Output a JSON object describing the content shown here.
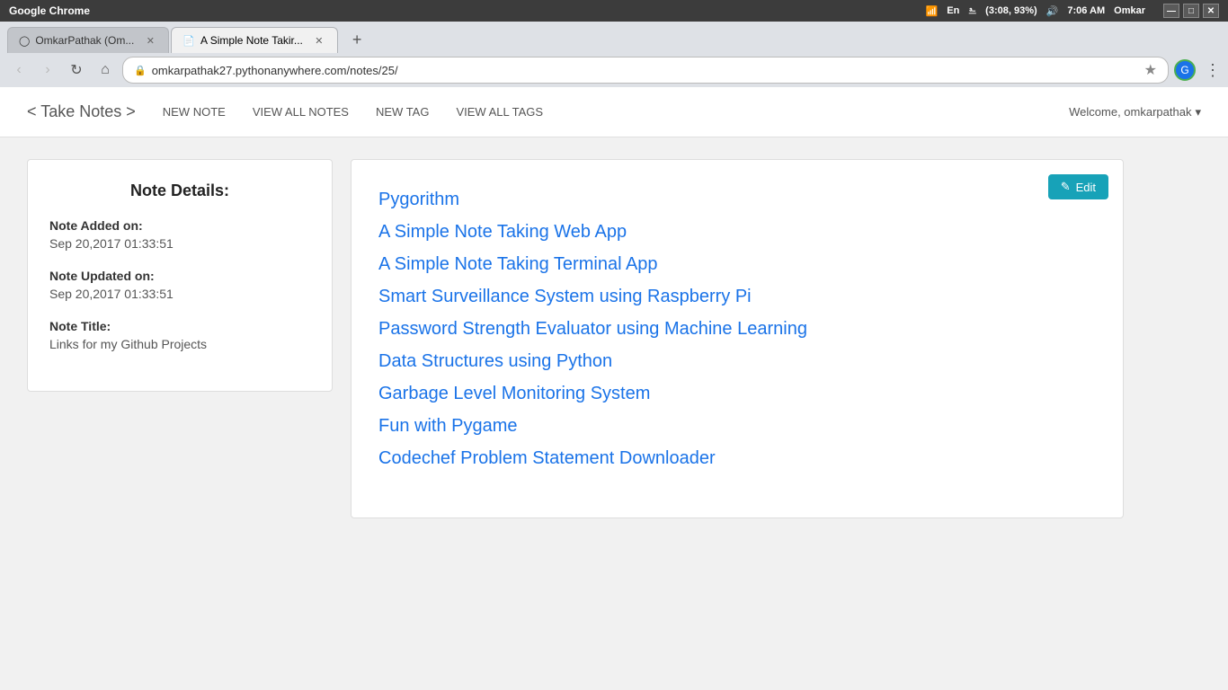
{
  "os": {
    "titlebar": "Google Chrome",
    "status_right": {
      "wifi": "wifi",
      "lang": "En",
      "bluetooth": "bluetooth",
      "battery": "(3:08, 93%)",
      "volume": "volume",
      "time": "7:06 AM",
      "user": "Omkar"
    },
    "window_controls": {
      "minimize": "—",
      "maximize": "□",
      "close": "✕"
    }
  },
  "browser": {
    "tabs": [
      {
        "id": "tab1",
        "icon": "github",
        "label": "OmkarPathak (Om...",
        "active": false,
        "close": "✕"
      },
      {
        "id": "tab2",
        "icon": "page",
        "label": "A Simple Note Takir...",
        "active": true,
        "close": "✕"
      }
    ],
    "new_tab_label": "+",
    "nav": {
      "back": "‹",
      "forward": "›",
      "reload": "↺",
      "home": "⌂"
    },
    "url": "omkarpathak27.pythonanywhere.com/notes/25/",
    "star": "☆",
    "menu": "⋮"
  },
  "navbar": {
    "brand": "< Take Notes >",
    "links": [
      {
        "id": "new-note",
        "label": "NEW NOTE"
      },
      {
        "id": "view-all-notes",
        "label": "VIEW ALL NOTES"
      },
      {
        "id": "new-tag",
        "label": "NEW TAG"
      },
      {
        "id": "view-all-tags",
        "label": "VIEW ALL TAGS"
      }
    ],
    "user_greeting": "Welcome, omkarpathak",
    "user_dropdown": "▾"
  },
  "note_details": {
    "title": "Note Details:",
    "added_label": "Note Added on:",
    "added_value": "Sep 20,2017 01:33:51",
    "updated_label": "Note Updated on:",
    "updated_value": "Sep 20,2017 01:33:51",
    "title_label": "Note Title:",
    "title_value": "Links for my Github Projects"
  },
  "note_body": {
    "edit_button": "Edit",
    "links": [
      {
        "id": "link1",
        "text": "Pygorithm"
      },
      {
        "id": "link2",
        "text": "A Simple Note Taking Web App"
      },
      {
        "id": "link3",
        "text": "A Simple Note Taking Terminal App"
      },
      {
        "id": "link4",
        "text": "Smart Surveillance System using Raspberry Pi"
      },
      {
        "id": "link5",
        "text": "Password Strength Evaluator using Machine Learning"
      },
      {
        "id": "link6",
        "text": "Data Structures using Python"
      },
      {
        "id": "link7",
        "text": "Garbage Level Monitoring System"
      },
      {
        "id": "link8",
        "text": "Fun with Pygame"
      },
      {
        "id": "link9",
        "text": "Codechef Problem Statement Downloader"
      }
    ]
  }
}
